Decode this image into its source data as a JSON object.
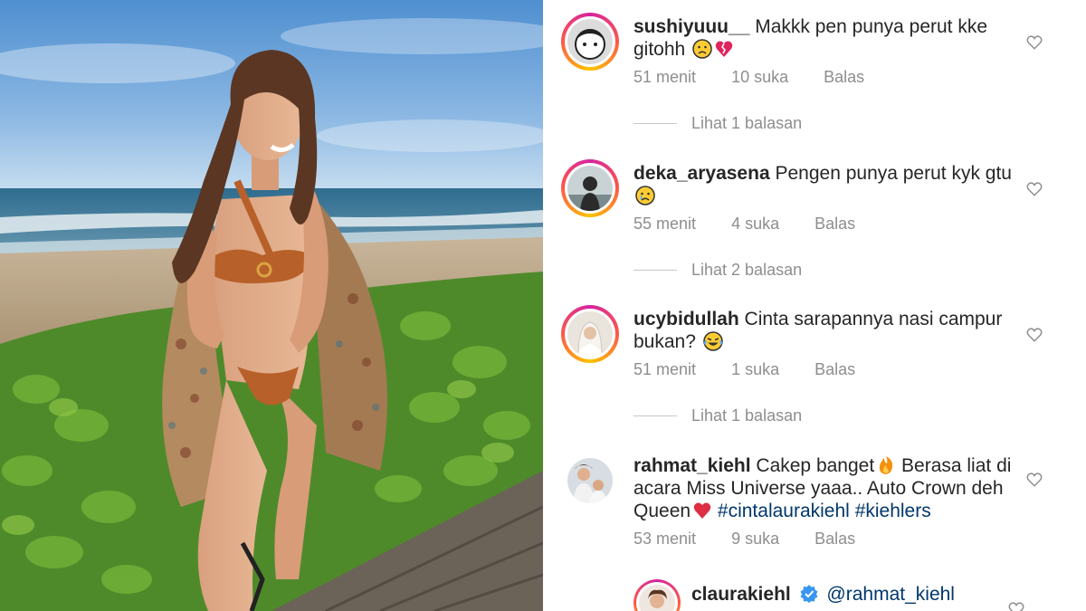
{
  "photo": {
    "description_icon": "beach-photo"
  },
  "comments": [
    {
      "username": "sushiyuuu__",
      "text": "Makkk pen punya perut kke gitohh",
      "time": "51 menit",
      "likes": "10 suka",
      "reply_label": "Balas",
      "view_replies": "Lihat 1 balasan"
    },
    {
      "username": "deka_aryasena",
      "text": "Pengen punya perut kyk gtu",
      "time": "55 menit",
      "likes": "4 suka",
      "reply_label": "Balas",
      "view_replies": "Lihat 2 balasan"
    },
    {
      "username": "ucybidullah",
      "text": "Cinta sarapannya nasi campur bukan?",
      "time": "51 menit",
      "likes": "1 suka",
      "reply_label": "Balas",
      "view_replies": "Lihat 1 balasan"
    },
    {
      "username": "rahmat_kiehl",
      "text_part1": "Cakep banget",
      "text_part2": " Berasa liat di acara Miss Universe yaaa.. Auto Crown deh Queen",
      "hashtag1": "#cintalaurakiehl",
      "hashtag2": "#kiehlers",
      "time": "53 menit",
      "likes": "9 suka",
      "reply_label": "Balas"
    },
    {
      "username": "claurakiehl",
      "mention": "@rahmat_kiehl"
    }
  ],
  "colors": {
    "text": "#262626",
    "muted": "#8e8e8e",
    "hashtag": "#00376b",
    "verified": "#3897f0"
  }
}
